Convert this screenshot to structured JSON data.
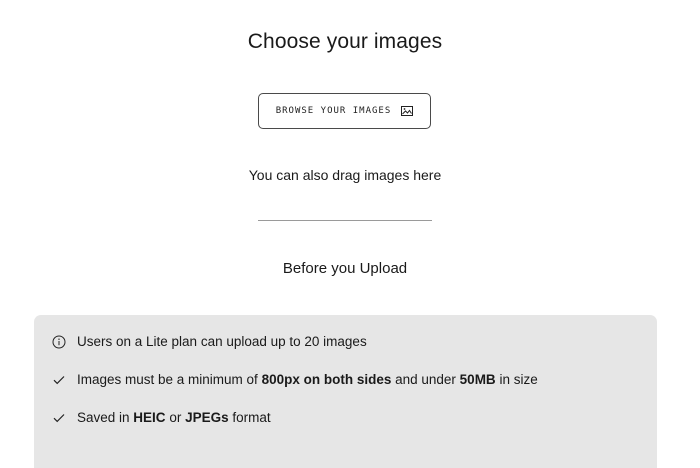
{
  "heading": "Choose your images",
  "browse_button": {
    "label": "BROWSE YOUR IMAGES",
    "icon": "image-icon"
  },
  "drag_hint": "You can also drag images here",
  "section_title": "Before you Upload",
  "requirements": [
    {
      "icon": "info-icon",
      "text": "Users on a Lite plan can upload up to 20 images"
    },
    {
      "icon": "check-icon",
      "text_prefix": "Images must be a minimum of ",
      "bold_1": "800px on both sides",
      "text_middle": " and under ",
      "bold_2": "50MB",
      "text_suffix": " in size"
    },
    {
      "icon": "check-icon",
      "text_prefix": "Saved in ",
      "bold_1": "HEIC",
      "text_middle": " or ",
      "bold_2": "JPEGs",
      "text_suffix": " format"
    }
  ],
  "colors": {
    "panel_background": "#e6e6e6",
    "button_border": "#4a4a4a",
    "text": "#1a1a1a"
  }
}
